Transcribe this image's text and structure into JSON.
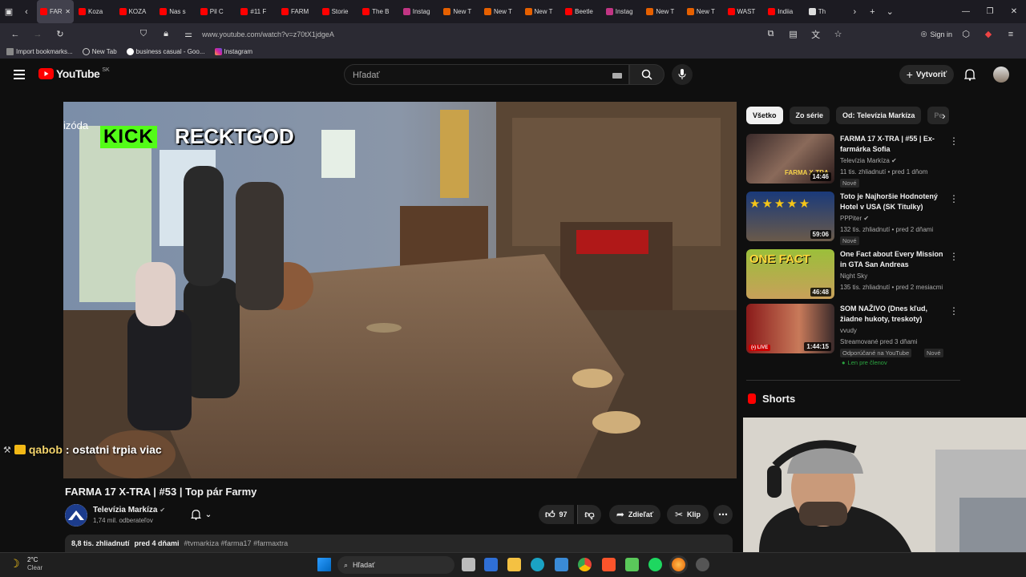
{
  "browser": {
    "tabs": [
      "FAR",
      "Koza",
      "KOZA",
      "Nas s",
      "Pil C",
      "#11 F",
      "FARM",
      "Storie",
      "The B",
      "Instag",
      "New T",
      "New T",
      "New T",
      "Beetle",
      "Instag",
      "New T",
      "New T",
      "WAST",
      "Indiia",
      "Th"
    ],
    "url": "www.youtube.com/watch?v=z70tX1jdgeA",
    "sign_in": "Sign in",
    "bookmarks": [
      "Import bookmarks...",
      "New Tab",
      "business casual - Goo...",
      "Instagram"
    ]
  },
  "header": {
    "logo": "YouTube",
    "region": "SK",
    "search_placeholder": "Hľadať",
    "create": "Vytvoriť"
  },
  "video": {
    "overlay_episode": "izóda",
    "overlay_kick": "KICK",
    "overlay_streamer": "RECKTGOD",
    "chat_user": "qabob",
    "chat_message": ": ostatni trpia viac",
    "title": "FARMA 17 X-TRA | #53 | Top pár Farmy",
    "channel": "Televízia Markíza",
    "subscribers": "1,74 mil. odberateľov",
    "likes": "97",
    "share": "Zdieľať",
    "clip": "Klip",
    "views": "8,8 tis. zhliadnutí",
    "date": "pred 4 dňami",
    "tags": "#tvmarkiza #farma17 #farmaxtra"
  },
  "sidebar": {
    "chips": [
      "Všetko",
      "Zo série",
      "Od: Televízia Markíza",
      "Pe"
    ],
    "recs": [
      {
        "title": "FARMA 17 X-TRA | #55 | Ex-farmárka Sofia",
        "channel": "Televízia Markíza",
        "meta": "11 tis. zhliadnutí • pred 1 dňom",
        "badge": "Nové",
        "duration": "14:46"
      },
      {
        "title": "Toto je Najhoršie Hodnotený Hotel v USA (SK Titulky)",
        "channel": "PPPiter",
        "meta": "132 tis. zhliadnutí • pred 2 dňami",
        "badge": "Nové",
        "duration": "59:06"
      },
      {
        "title": "One Fact about Every Mission in GTA San Andreas",
        "channel": "Night Sky",
        "meta": "135 tis. zhliadnutí • pred 2 mesiacmi",
        "badge": "",
        "duration": "46:48"
      },
      {
        "title": "SOM NAŽIVO (Dnes kľud, žiadne hukoty, treskoty)",
        "channel": "vvudy",
        "meta": "Streamované pred 3 dňami",
        "badge": "Odporúčané na YouTube",
        "badge2": "Nové",
        "members": "Len pre členov",
        "duration": "1:44:15",
        "live": "LIVE"
      }
    ],
    "shorts": "Shorts"
  },
  "taskbar": {
    "temp": "2°C",
    "weather": "Clear",
    "search": "Hľadať"
  }
}
